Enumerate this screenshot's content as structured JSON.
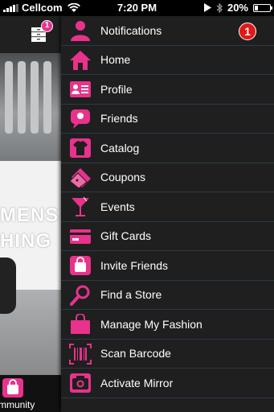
{
  "status_bar": {
    "carrier": "Cellcom",
    "time": "7:20 PM",
    "battery": "20%",
    "battery_level": 0.2,
    "signal_bars": 4
  },
  "background": {
    "banner_line1": "MENS",
    "banner_line2": "HING",
    "notification_badge": "1",
    "tab_label": "mmunity"
  },
  "colors": {
    "accent_pink": "#e8328c",
    "menu_bg": "#1f1f1f",
    "badge_red": "#e21818"
  },
  "menu": {
    "items": [
      {
        "label": "Notifications",
        "icon": "person-icon",
        "badge": "1"
      },
      {
        "label": "Home",
        "icon": "home-icon"
      },
      {
        "label": "Profile",
        "icon": "profile-card-icon"
      },
      {
        "label": "Friends",
        "icon": "chat-bubble-icon"
      },
      {
        "label": "Catalog",
        "icon": "shirt-icon"
      },
      {
        "label": "Coupons",
        "icon": "coupon-icon"
      },
      {
        "label": "Events",
        "icon": "cocktail-icon"
      },
      {
        "label": "Gift Cards",
        "icon": "gift-card-icon"
      },
      {
        "label": "Invite Friends",
        "icon": "shopping-bag-icon"
      },
      {
        "label": "Find a Store",
        "icon": "magnifier-icon"
      },
      {
        "label": "Manage My Fashion",
        "icon": "shopping-bag-icon"
      },
      {
        "label": "Scan Barcode",
        "icon": "barcode-icon"
      },
      {
        "label": "Activate Mirror",
        "icon": "camera-icon"
      }
    ]
  }
}
